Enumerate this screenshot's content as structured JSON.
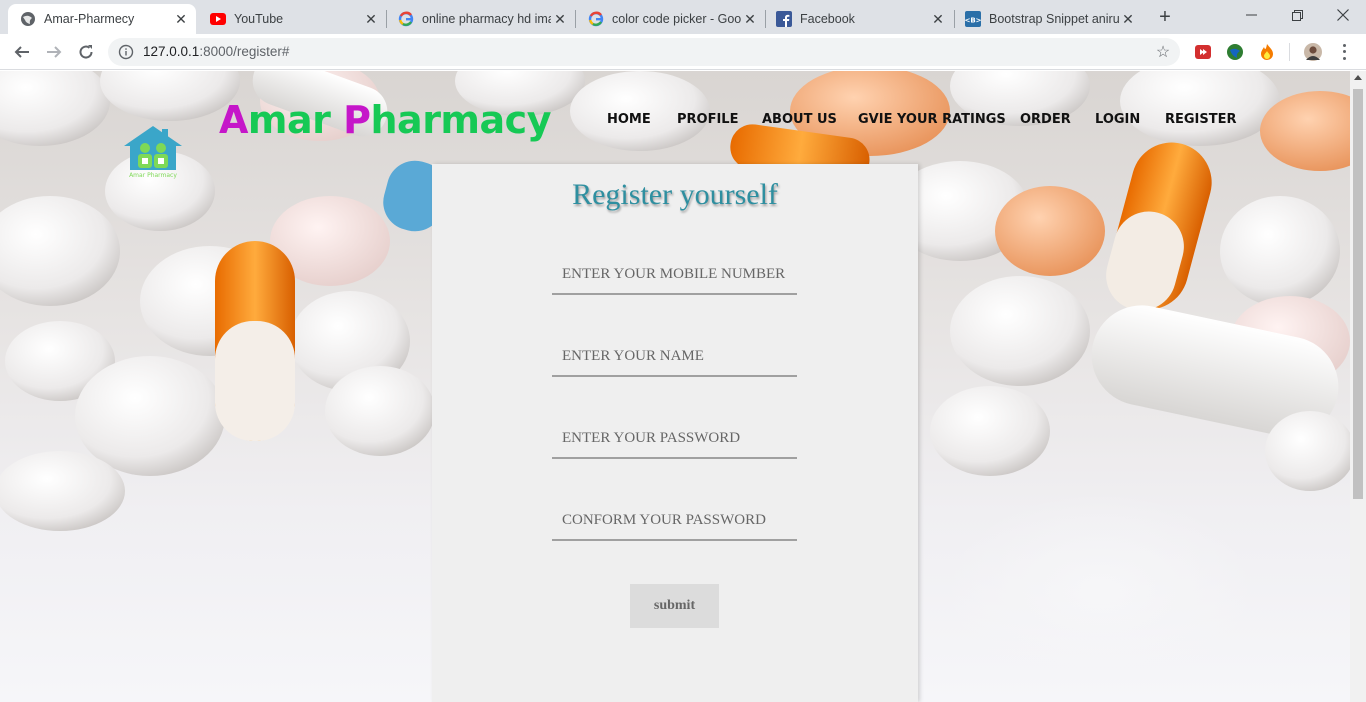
{
  "browser": {
    "tabs": [
      {
        "title": "Amar-Pharmecy",
        "favicon": "globe-icon",
        "active": true
      },
      {
        "title": "YouTube",
        "favicon": "youtube-icon",
        "active": false
      },
      {
        "title": "online pharmacy hd ima",
        "favicon": "google-icon",
        "active": false
      },
      {
        "title": "color code picker - Goo",
        "favicon": "google-icon",
        "active": false
      },
      {
        "title": "Facebook",
        "favicon": "facebook-icon",
        "active": false
      },
      {
        "title": "Bootstrap Snippet aniru",
        "favicon": "bootstrap-icon",
        "active": false
      }
    ],
    "url_host": "127.0.0.1",
    "url_path": ":8000/register#",
    "colors": {
      "tabstrip": "#dee1e6",
      "omnibox": "#f1f3f4"
    }
  },
  "site": {
    "brand_cap1": "A",
    "brand_rest1": "mar ",
    "brand_cap2": "P",
    "brand_rest2": "harmacy",
    "logo_caption": "Amar Pharmacy",
    "brand_colors": {
      "caps": "#c516c9",
      "rest": "#16c955"
    },
    "nav": [
      "HOME",
      "PROFILE",
      "ABOUT US",
      "GVIE YOUR RATINGS",
      "ORDER",
      "LOGIN",
      "REGISTER"
    ]
  },
  "form": {
    "title": "Register yourself",
    "title_color": "#2e8fa0",
    "mobile_placeholder": "ENTER YOUR MOBILE NUMBER",
    "name_placeholder": "ENTER YOUR NAME",
    "password_placeholder": "ENTER YOUR PASSWORD",
    "confirm_placeholder": "CONFORM YOUR PASSWORD",
    "submit_label": "submit"
  }
}
